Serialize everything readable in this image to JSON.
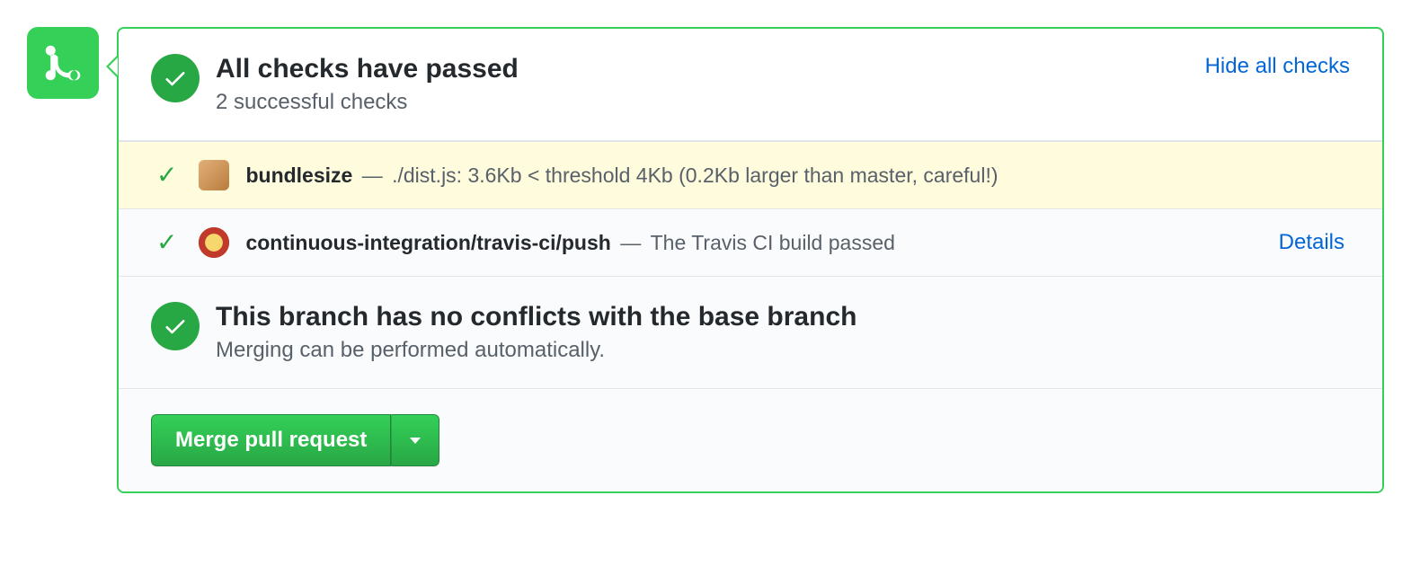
{
  "header": {
    "title": "All checks have passed",
    "subtitle": "2 successful checks",
    "hide_link": "Hide all checks"
  },
  "checks": [
    {
      "name": "bundlesize",
      "message": "./dist.js: 3.6Kb < threshold 4Kb (0.2Kb larger than master, careful!)",
      "highlight": true,
      "details": ""
    },
    {
      "name": "continuous-integration/travis-ci/push",
      "message": "The Travis CI build passed",
      "highlight": false,
      "details": "Details"
    }
  ],
  "conflicts": {
    "title": "This branch has no conflicts with the base branch",
    "subtitle": "Merging can be performed automatically."
  },
  "merge": {
    "button_label": "Merge pull request"
  }
}
